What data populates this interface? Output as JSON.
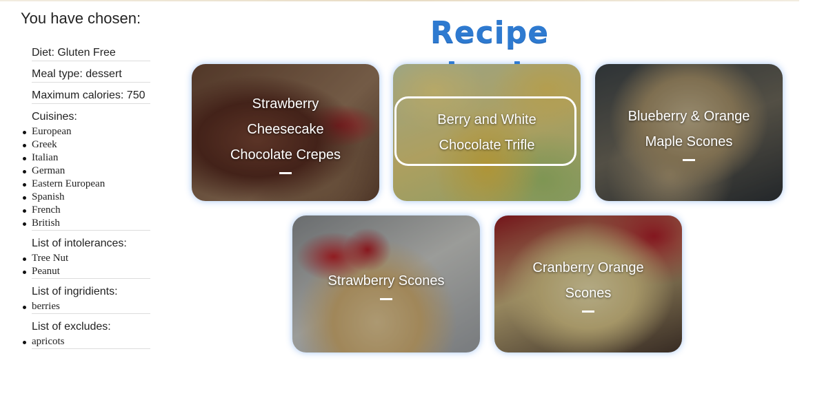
{
  "sidebar": {
    "title": "You have chosen:",
    "diet": "Diet: Gluten Free",
    "meal_type": "Meal type: dessert",
    "max_calories": "Maximum calories: 750",
    "cuisines": {
      "heading": "Cuisines:",
      "items": [
        "European",
        "Greek",
        "Italian",
        "German",
        "Eastern European",
        "Spanish",
        "French",
        "British"
      ]
    },
    "intolerances": {
      "heading": "List of intolerances:",
      "items": [
        "Tree Nut",
        "Peanut"
      ]
    },
    "ingredients": {
      "heading": "List of ingridients:",
      "items": [
        "berries"
      ]
    },
    "excludes": {
      "heading": "List of excludes:",
      "items": [
        "apricots"
      ]
    }
  },
  "header": {
    "title": "Recipe book",
    "title_color": "#2e7ad0"
  },
  "recipes": [
    {
      "title": "Strawberry Cheesecake Chocolate Crepes"
    },
    {
      "title": "Berry and White Chocolate Trifle",
      "hovered": true
    },
    {
      "title": "Blueberry & Orange Maple Scones"
    },
    {
      "title": "Strawberry Scones"
    },
    {
      "title": "Cranberry Orange Scones"
    }
  ]
}
